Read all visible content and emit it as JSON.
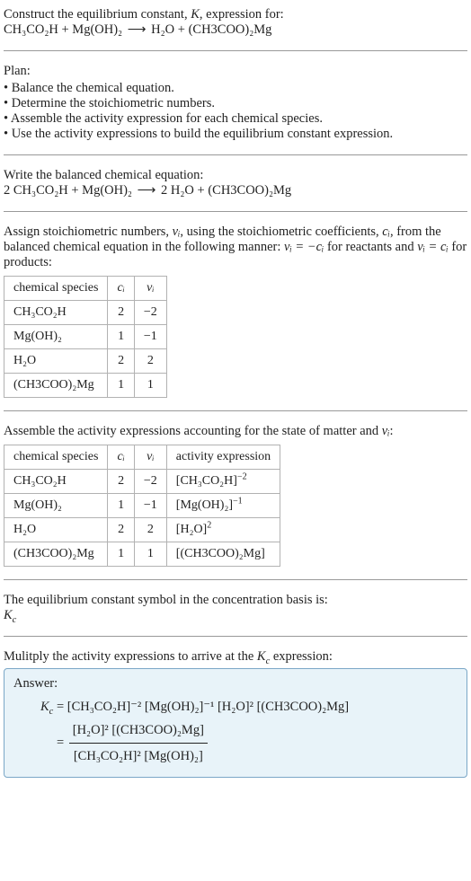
{
  "intro": {
    "line1": "Construct the equilibrium constant, ",
    "Kital": "K",
    "line1b": ", expression for:",
    "eq_lhs": "CH₃CO₂H + Mg(OH)₂",
    "arrow": "⟶",
    "eq_rhs": "H₂O + (CH3COO)₂Mg"
  },
  "plan": {
    "title": "Plan:",
    "items": [
      "• Balance the chemical equation.",
      "• Determine the stoichiometric numbers.",
      "• Assemble the activity expression for each chemical species.",
      "• Use the activity expressions to build the equilibrium constant expression."
    ]
  },
  "balanced": {
    "title": "Write the balanced chemical equation:",
    "lhs": "2 CH₃CO₂H + Mg(OH)₂",
    "arrow": "⟶",
    "rhs": "2 H₂O + (CH3COO)₂Mg"
  },
  "stoich": {
    "intro_a": "Assign stoichiometric numbers, ",
    "nu_i": "νᵢ",
    "intro_b": ", using the stoichiometric coefficients, ",
    "c_i": "cᵢ",
    "intro_c": ", from the balanced chemical equation in the following manner: ",
    "rule1": "νᵢ = −cᵢ",
    "intro_d": " for reactants and ",
    "rule2": "νᵢ = cᵢ",
    "intro_e": " for products:"
  },
  "table1": {
    "headers": [
      "chemical species",
      "cᵢ",
      "νᵢ"
    ],
    "rows": [
      [
        "CH₃CO₂H",
        "2",
        "−2"
      ],
      [
        "Mg(OH)₂",
        "1",
        "−1"
      ],
      [
        "H₂O",
        "2",
        "2"
      ],
      [
        "(CH3COO)₂Mg",
        "1",
        "1"
      ]
    ]
  },
  "assemble": {
    "title_a": "Assemble the activity expressions accounting for the state of matter and ",
    "nu_i": "νᵢ",
    "title_b": ":"
  },
  "table2": {
    "headers": [
      "chemical species",
      "cᵢ",
      "νᵢ",
      "activity expression"
    ],
    "rows": [
      {
        "sp": "CH₃CO₂H",
        "c": "2",
        "nu": "−2",
        "act_base": "[CH₃CO₂H]",
        "act_exp": "−2"
      },
      {
        "sp": "Mg(OH)₂",
        "c": "1",
        "nu": "−1",
        "act_base": "[Mg(OH)₂]",
        "act_exp": "−1"
      },
      {
        "sp": "H₂O",
        "c": "2",
        "nu": "2",
        "act_base": "[H₂O]",
        "act_exp": "2"
      },
      {
        "sp": "(CH3COO)₂Mg",
        "c": "1",
        "nu": "1",
        "act_base": "[(CH3COO)₂Mg]",
        "act_exp": ""
      }
    ]
  },
  "basis": {
    "line": "The equilibrium constant symbol in the concentration basis is:",
    "Kc": "K",
    "Kc_sub": "c"
  },
  "multiply": {
    "line_a": "Mulitply the activity expressions to arrive at the ",
    "Kc": "K",
    "Kc_sub": "c",
    "line_b": " expression:"
  },
  "answer": {
    "label": "Answer:",
    "Kc": "K",
    "Kc_sub": "c",
    "eq1": " = [CH₃CO₂H]⁻² [Mg(OH)₂]⁻¹ [H₂O]² [(CH3COO)₂Mg]",
    "eq2_prefix": " = ",
    "num": "[H₂O]² [(CH3COO)₂Mg]",
    "den": "[CH₃CO₂H]² [Mg(OH)₂]"
  }
}
